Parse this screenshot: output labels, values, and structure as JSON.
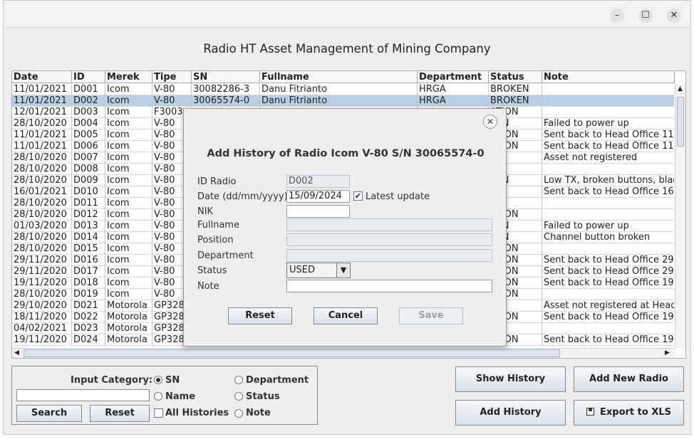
{
  "app": {
    "title": "Radio HT Asset Management of Mining Company"
  },
  "titlebar": {
    "minimize": "–",
    "maximize": "☐",
    "close": "✕"
  },
  "table": {
    "columns": [
      "Date",
      "ID",
      "Merek",
      "Tipe",
      "SN",
      "Fullname",
      "Department",
      "Status",
      "Note"
    ],
    "rows": [
      [
        "11/01/2021",
        "D001",
        "Icom",
        "V-80",
        "30082286-3",
        "Danu Fitrianto",
        "HRGA",
        "BROKEN",
        ""
      ],
      [
        "11/01/2021",
        "D002",
        "Icom",
        "V-80",
        "30065574-0",
        "Danu Fitrianto",
        "HRGA",
        "BROKEN",
        ""
      ],
      [
        "12/01/2021",
        "D003",
        "Icom",
        "F3003",
        "",
        "",
        "",
        "ATION",
        ""
      ],
      [
        "28/10/2020",
        "D004",
        "Icom",
        "V-80",
        "",
        "",
        "",
        "KEN",
        "Failed to power up"
      ],
      [
        "11/01/2021",
        "D005",
        "Icom",
        "V-80",
        "",
        "",
        "",
        "ATION",
        "Sent back to Head Office 11/"
      ],
      [
        "11/01/2021",
        "D006",
        "Icom",
        "V-80",
        "",
        "",
        "",
        "ATION",
        "Sent back to Head Office 11/"
      ],
      [
        "28/10/2020",
        "D007",
        "Icom",
        "V-80",
        "",
        "",
        "",
        "",
        "Asset not registered"
      ],
      [
        "28/10/2020",
        "D008",
        "Icom",
        "V-80",
        "",
        "",
        "",
        "D",
        ""
      ],
      [
        "28/10/2020",
        "D009",
        "Icom",
        "V-80",
        "",
        "",
        "",
        "KEN",
        "Low TX, broken buttons, blac"
      ],
      [
        "16/01/2021",
        "D010",
        "Icom",
        "V-80",
        "",
        "",
        "",
        "D",
        "Sent back to Head Office 16/"
      ],
      [
        "28/10/2020",
        "D011",
        "Icom",
        "V-80",
        "",
        "",
        "",
        "D",
        ""
      ],
      [
        "28/10/2020",
        "D012",
        "Icom",
        "V-80",
        "",
        "",
        "",
        "ATION",
        ""
      ],
      [
        "01/03/2020",
        "D013",
        "Icom",
        "V-80",
        "",
        "",
        "",
        "KEN",
        "Failed to power up"
      ],
      [
        "28/10/2020",
        "D014",
        "Icom",
        "V-80",
        "",
        "",
        "",
        "KEN",
        "Channel button broken"
      ],
      [
        "28/10/2020",
        "D015",
        "Icom",
        "V-80",
        "",
        "",
        "",
        "ATION",
        ""
      ],
      [
        "29/11/2020",
        "D016",
        "Icom",
        "V-80",
        "",
        "",
        "",
        "ATION",
        "Sent back to Head Office 29/"
      ],
      [
        "29/11/2020",
        "D017",
        "Icom",
        "V-80",
        "",
        "",
        "",
        "ATION",
        "Sent back to Head Office 29/"
      ],
      [
        "19/11/2020",
        "D018",
        "Icom",
        "V-80",
        "",
        "",
        "",
        "ATION",
        "Sent back to Head Office 19/"
      ],
      [
        "28/10/2020",
        "D019",
        "Icom",
        "V-80",
        "",
        "",
        "",
        "ATION",
        ""
      ],
      [
        "29/10/2020",
        "D021",
        "Motorola",
        "GP328",
        "",
        "",
        "",
        "T",
        "Asset not registered at Head"
      ],
      [
        "18/11/2020",
        "D022",
        "Motorola",
        "GP328",
        "",
        "",
        "",
        "ATION",
        "Sent back to Head Office 19/"
      ],
      [
        "04/02/2021",
        "D023",
        "Motorola",
        "GP328",
        "",
        "",
        "",
        "D",
        ""
      ],
      [
        "19/11/2020",
        "D024",
        "Motorola",
        "GP328",
        "",
        "",
        "",
        "ATION",
        "Sent back to Head Office 19/"
      ]
    ],
    "selected_row": 1
  },
  "dialog": {
    "close": "✕",
    "title": "Add History of Radio Icom V-80 S/N 30065574-0",
    "labels": {
      "id_radio": "ID Radio",
      "date": "Date (dd/mm/yyyy)",
      "nik": "NIK",
      "fullname": "Fullname",
      "position": "Position",
      "department": "Department",
      "status": "Status",
      "note": "Note"
    },
    "values": {
      "id_radio": "D002",
      "date": "15/09/2024",
      "nik": "",
      "fullname": "",
      "position": "",
      "department": "",
      "status": "USED",
      "note": ""
    },
    "latest_update_label": "Latest update",
    "latest_update_checked": true,
    "buttons": {
      "reset": "Reset",
      "cancel": "Cancel",
      "save": "Save"
    }
  },
  "search": {
    "category_label": "Input Category:",
    "options": [
      "SN",
      "Department",
      "Name",
      "Status",
      "Note"
    ],
    "selected_option": "SN",
    "all_histories_label": "All Histories",
    "input_value": "",
    "search_button": "Search",
    "reset_button": "Reset"
  },
  "actions": {
    "show_history": "Show History",
    "add_new_radio": "Add New Radio",
    "add_history": "Add History",
    "export_xls": "Export to XLS"
  }
}
